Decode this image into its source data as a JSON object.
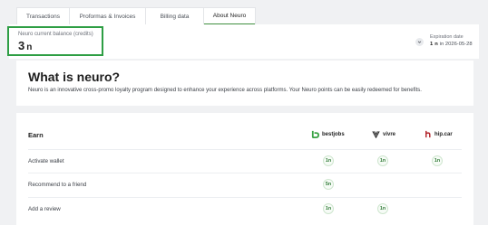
{
  "tabs": [
    {
      "label": "Transactions"
    },
    {
      "label": "Proformas & Invoices"
    },
    {
      "label": "Billing data"
    },
    {
      "label": "About Neuro",
      "active": true
    }
  ],
  "balance": {
    "label": "Neuro current balance (credits)",
    "value": "3",
    "unit_glyph": "n"
  },
  "expiration": {
    "label": "Expiration date",
    "value": "1",
    "unit_glyph": "n",
    "date_text": "in 2026-05-28"
  },
  "intro": {
    "title": "What is neuro?",
    "text": "Neuro is an innovative cross-promo loyalty program designed to enhance your experience across platforms. Your Neuro points can be easily redeemed for benefits."
  },
  "earn": {
    "title": "Earn",
    "brands": [
      {
        "name": "bestjobs",
        "icon": "bestjobs-logo-icon",
        "color": "#3aa345"
      },
      {
        "name": "vivre",
        "icon": "vivre-logo-icon",
        "color": "#1e1e1e"
      },
      {
        "name": "hip.car",
        "icon": "hipcar-logo-icon",
        "color": "#b3262c"
      }
    ],
    "rows": [
      {
        "label": "Activate wallet",
        "values": [
          "1n",
          "1n",
          "1n"
        ]
      },
      {
        "label": "Recommend to a friend",
        "values": [
          "5n",
          "",
          ""
        ]
      },
      {
        "label": "Add a review",
        "values": [
          "1n",
          "1n",
          ""
        ]
      }
    ]
  },
  "colors": {
    "accent_green": "#2e9e44",
    "page_bg": "#f0f1f3"
  }
}
